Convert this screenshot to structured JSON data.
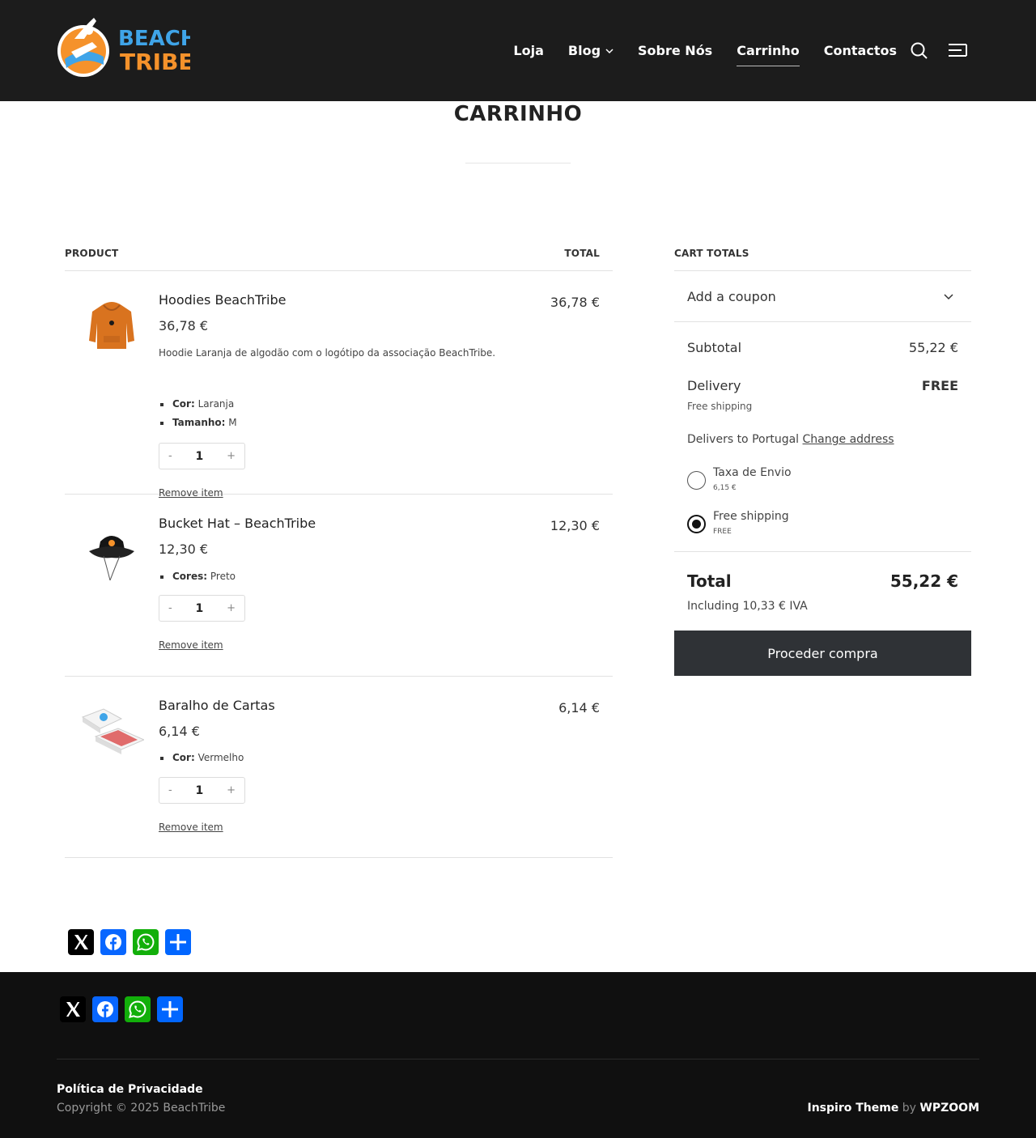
{
  "brand": {
    "logo_line1": "BEACH",
    "logo_line2": "TRIBE"
  },
  "nav": {
    "items": [
      {
        "label": "Loja",
        "active": false,
        "has_dropdown": false
      },
      {
        "label": "Blog",
        "active": false,
        "has_dropdown": true
      },
      {
        "label": "Sobre Nós",
        "active": false,
        "has_dropdown": false
      },
      {
        "label": "Carrinho",
        "active": true,
        "has_dropdown": false
      },
      {
        "label": "Contactos",
        "active": false,
        "has_dropdown": false
      }
    ],
    "icons": [
      "search-icon",
      "menu-icon"
    ]
  },
  "page": {
    "title": "CARRINHO"
  },
  "cart": {
    "headers": {
      "product": "PRODUCT",
      "total": "TOTAL"
    },
    "items": [
      {
        "name": "Hoodies BeachTribe",
        "price": "36,78 €",
        "description": "Hoodie Laranja de algodão com o logótipo da associação BeachTribe.",
        "attributes": [
          {
            "key": "Cor:",
            "value": " Laranja"
          },
          {
            "key": "Tamanho:",
            "value": " M"
          }
        ],
        "quantity": "1",
        "total": "36,78 €",
        "remove_label": "Remove item",
        "thumb_icon": "hoodie-icon"
      },
      {
        "name": "Bucket Hat – BeachTribe",
        "price": "12,30 €",
        "attributes": [
          {
            "key": "Cores:",
            "value": " Preto"
          }
        ],
        "quantity": "1",
        "total": "12,30 €",
        "remove_label": "Remove item",
        "thumb_icon": "bucket-hat-icon"
      },
      {
        "name": "Baralho de Cartas",
        "price": "6,14 €",
        "attributes": [
          {
            "key": "Cor:",
            "value": " Vermelho"
          }
        ],
        "quantity": "1",
        "total": "6,14 €",
        "remove_label": "Remove item",
        "thumb_icon": "playing-cards-icon"
      }
    ],
    "qty_minus": "-",
    "qty_plus": "+"
  },
  "totals": {
    "heading": "CART TOTALS",
    "coupon_label": "Add a coupon",
    "subtotal_label": "Subtotal",
    "subtotal_value": "55,22 €",
    "delivery_label": "Delivery",
    "delivery_value": "FREE",
    "delivery_method": "Free shipping",
    "delivers_to": "Delivers to Portugal",
    "change_address": "Change address",
    "shipping_options": [
      {
        "label": "Taxa de Envio",
        "price": "6,15 €",
        "selected": false
      },
      {
        "label": "Free shipping",
        "price": "FREE",
        "selected": true
      }
    ],
    "total_label": "Total",
    "total_value": "55,22 €",
    "tax_note": "Including 10,33 € IVA",
    "checkout_label": "Proceder compra"
  },
  "share": {
    "buttons": [
      "x-icon",
      "facebook-icon",
      "whatsapp-icon",
      "share-icon"
    ],
    "colors": {
      "x": "#000000",
      "facebook": "#0866ff",
      "whatsapp": "#12af0a",
      "share": "#0166ff"
    }
  },
  "footer": {
    "privacy_link": "Política de Privacidade",
    "copyright": "Copyright © 2025 BeachTribe",
    "credit_theme": "Inspiro Theme",
    "credit_by": " by ",
    "credit_company": "WPZOOM"
  },
  "colors": {
    "header_bg": "#1c1c1c",
    "footer_bg": "#101010",
    "checkout_bg": "#2f3236",
    "logo_orange": "#f5922b",
    "logo_blue": "#3fa4e8"
  }
}
